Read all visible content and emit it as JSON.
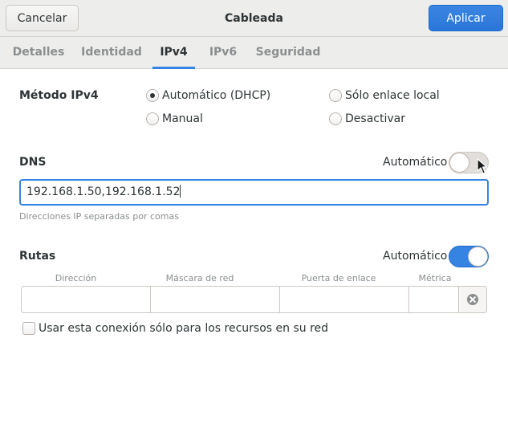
{
  "header": {
    "title": "Cableada",
    "cancel_label": "Cancelar",
    "apply_label": "Aplicar"
  },
  "tabs": [
    {
      "label": "Detalles",
      "active": false
    },
    {
      "label": "Identidad",
      "active": false
    },
    {
      "label": "IPv4",
      "active": true
    },
    {
      "label": "IPv6",
      "active": false
    },
    {
      "label": "Seguridad",
      "active": false
    }
  ],
  "ipv4_method": {
    "label": "Método IPv4",
    "options": [
      {
        "label": "Automático (DHCP)",
        "checked": true
      },
      {
        "label": "Sólo enlace local",
        "checked": false
      },
      {
        "label": "Manual",
        "checked": false
      },
      {
        "label": "Desactivar",
        "checked": false
      }
    ]
  },
  "dns": {
    "label": "DNS",
    "auto_label": "Automático",
    "auto_on": false,
    "value": "192.168.1.50,192.168.1.52",
    "hint": "Direcciones IP separadas por comas"
  },
  "routes": {
    "label": "Rutas",
    "auto_label": "Automático",
    "auto_on": true,
    "columns": [
      "Dirección",
      "Máscara de red",
      "Puerta de enlace",
      "Métrica"
    ]
  },
  "only_local": {
    "label": "Usar esta conexión sólo para los recursos en su red",
    "checked": false
  },
  "colors": {
    "accent": "#3584e4",
    "headerbar": "#ededeb"
  }
}
